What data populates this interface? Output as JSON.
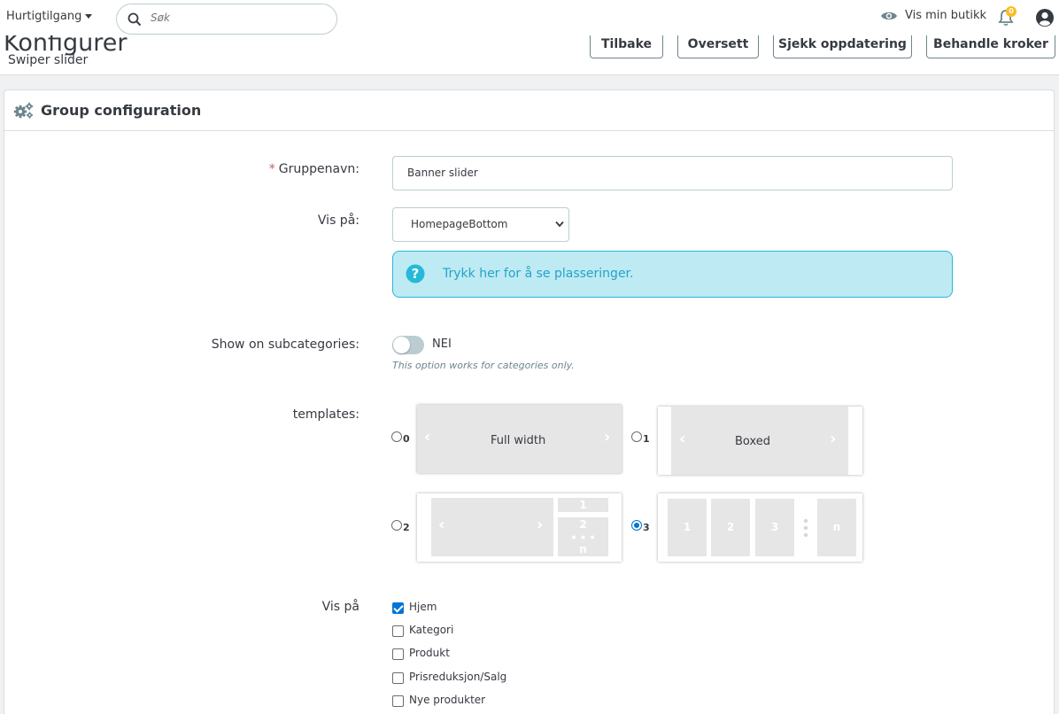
{
  "topbar": {
    "quick_access": "Hurtigtilgang",
    "search_placeholder": "Søk",
    "view_shop": "Vis min butikk",
    "notification_count": "0"
  },
  "header": {
    "title": "Konfigurer",
    "subtitle": "Swiper slider",
    "buttons": [
      "Tilbake",
      "Oversett",
      "Sjekk oppdatering",
      "Behandle kroker"
    ]
  },
  "panel": {
    "title": "Group configuration",
    "group_name": {
      "label": "Gruppenavn:",
      "value": "Banner slider"
    },
    "display_on": {
      "label": "Vis på:",
      "value": "HomepageBottom"
    },
    "alert": "Trykk her for å se plasseringer.",
    "subcategories": {
      "label": "Show on subcategories:",
      "state": "NEI",
      "help": "This option works for categories only."
    },
    "templates": {
      "label": "templates:",
      "options": [
        {
          "num": "0",
          "name": "Full width",
          "selected": false
        },
        {
          "num": "1",
          "name": "Boxed",
          "selected": false
        },
        {
          "num": "2",
          "name": "",
          "selected": false,
          "marks": [
            "1",
            "2",
            "n"
          ]
        },
        {
          "num": "3",
          "name": "",
          "selected": true,
          "marks": [
            "1",
            "2",
            "3",
            "n"
          ]
        }
      ]
    },
    "pages": {
      "label": "Vis på",
      "items": [
        {
          "label": "Hjem",
          "checked": true
        },
        {
          "label": "Kategori",
          "checked": false
        },
        {
          "label": "Produkt",
          "checked": false
        },
        {
          "label": "Prisreduksjon/Salg",
          "checked": false
        },
        {
          "label": "Nye produkter",
          "checked": false
        }
      ]
    }
  },
  "colors": {
    "accent": "#25b9d7",
    "checkbox": "#0075d6",
    "required": "#c05c67"
  }
}
